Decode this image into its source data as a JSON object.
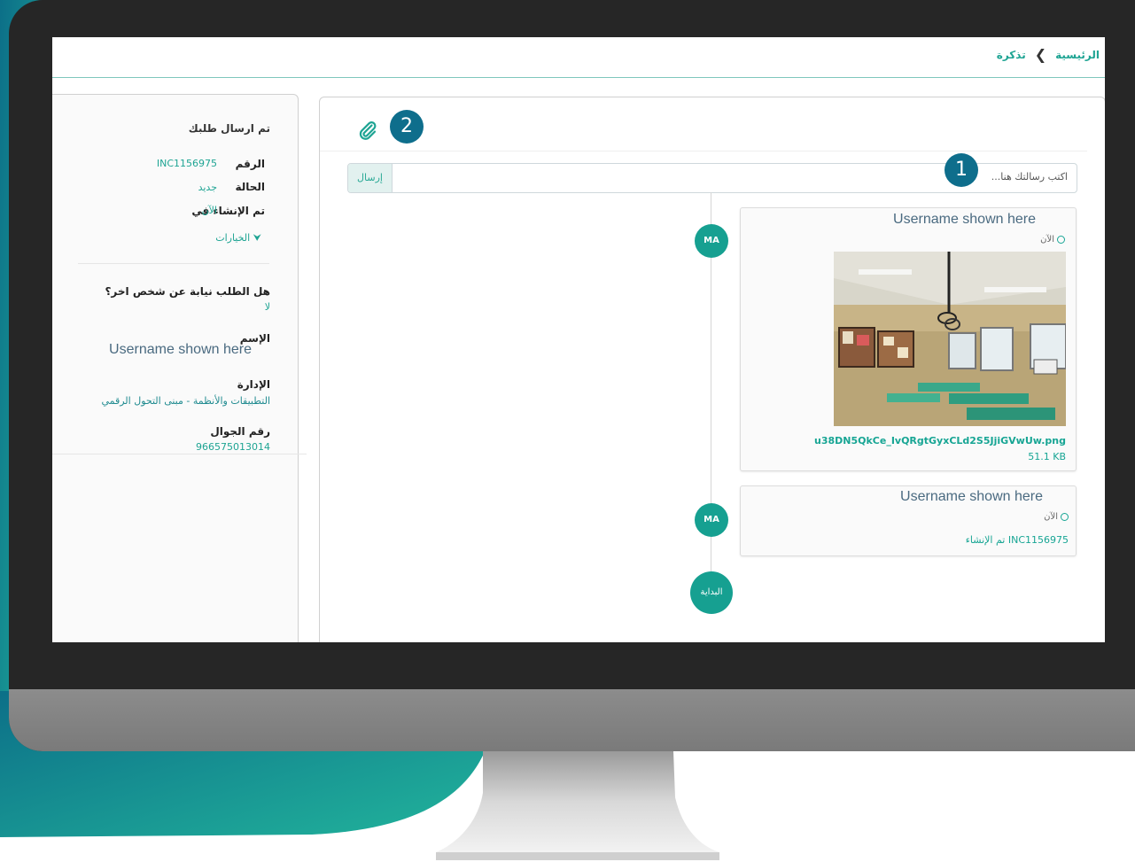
{
  "breadcrumb": {
    "home": "الرئيسية",
    "current": "تذكرة"
  },
  "chat": {
    "placeholder": "اكتب رسالتك هنا...",
    "send": "إرسال",
    "callout_1": "1",
    "callout_2": "2",
    "messages": [
      {
        "avatar": "MA",
        "user": "Username shown here",
        "time": "الآن",
        "file_name": "u38DN5QkCe_IvQRgtGyxCLd2S5JjiGVwUw.png",
        "file_size": "51.1 KB"
      },
      {
        "avatar": "MA",
        "user": "Username shown here",
        "time": "الآن",
        "text": "INC1156975 تم الإنشاء"
      }
    ],
    "start": "البداية"
  },
  "request": {
    "title": "تم ارسال طلبك",
    "number_label": "الرقم",
    "number_value": "INC1156975",
    "status_label": "الحالة",
    "status_value": "جديد",
    "created_label": "تم الإنشاء في",
    "created_value": "الآن",
    "options": "الخيارات",
    "on_behalf_q": "هل الطلب نيابة عن شخص اخر؟",
    "on_behalf_a": "لا",
    "name_label": "الإسم",
    "name_value": "Username shown here",
    "dept_label": "الإدارة",
    "dept_value": "التطبيقات والأنظمة - مبنى التحول الرقمي",
    "mobile_label": "رقم الجوال",
    "mobile_value": "966575013014"
  },
  "colors": {
    "accent": "#16a091",
    "callout": "#0e6e8c",
    "monitor": "#262626",
    "wave": "#1aa394"
  },
  "icons": {
    "attach": "paperclip-icon",
    "clock": "clock-icon",
    "options": "chevron-down-icon",
    "breadcrumb_sep": "chevron-left-icon"
  }
}
